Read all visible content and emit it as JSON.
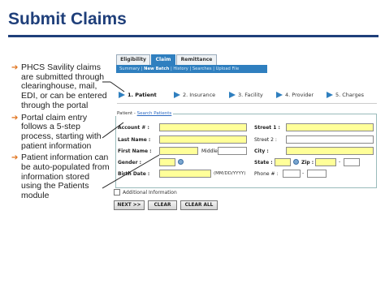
{
  "slide": {
    "title": "Submit Claims",
    "bullets": [
      "PHCS Savility claims are submitted through clearinghouse, mail, EDI, or can be entered through the portal",
      "Portal claim entry follows a 5-step process, starting with patient information",
      "Patient information can be auto-populated from information stored using the Patients module"
    ]
  },
  "app": {
    "tabs": [
      "Eligibility",
      "Claim",
      "Remittance"
    ],
    "active_tab": "Claim",
    "subnav": [
      "Summary",
      "New Batch",
      "History",
      "Searches",
      "Upload File"
    ],
    "steps": [
      "1. Patient",
      "2. Insurance",
      "3. Facility",
      "4. Provider",
      "5. Charges"
    ],
    "patient_legend": "Patient",
    "search_patients_link": "Search Patients",
    "labels": {
      "account": "Account # :",
      "last_name": "Last Name :",
      "first_name": "First Name :",
      "middle": "Middle",
      "gender": "Gender :",
      "birth_date": "Birth Date :",
      "date_hint": "(MM/DD/YYYY)",
      "street1": "Street 1 :",
      "street2": "Street 2 :",
      "city": "City :",
      "state": "State :",
      "zip": "Zip :",
      "phone": "Phone # :"
    },
    "additional_information": "Additional Information",
    "buttons": {
      "next": "NEXT >>",
      "clear": "CLEAR",
      "clear_all": "CLEAR ALL"
    },
    "colors": {
      "accent": "#2f7fbf",
      "required_field": "#ffff99",
      "title": "#1f3f7a",
      "bullet_arrow": "#e0721b"
    }
  }
}
